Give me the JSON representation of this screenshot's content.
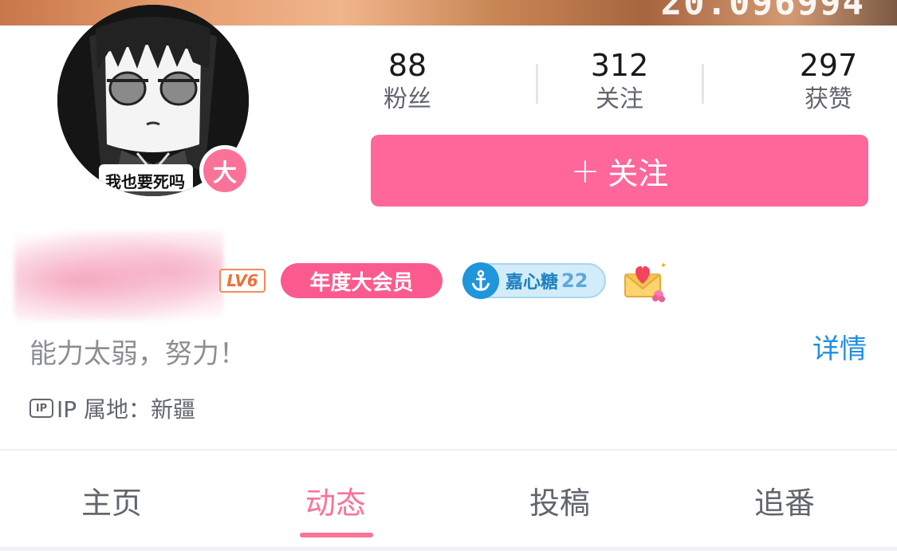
{
  "banner": {
    "overlay_text": "20.096994"
  },
  "avatar": {
    "caption": "我也要死吗",
    "level_badge": "大"
  },
  "stats": [
    {
      "value": "88",
      "label": "粉丝"
    },
    {
      "value": "312",
      "label": "关注"
    },
    {
      "value": "297",
      "label": "获赞"
    }
  ],
  "follow_button": {
    "plus": "+",
    "label": "关注"
  },
  "badges": {
    "level": "LV6",
    "vip": "年度大会员",
    "fan_medal_name": "嘉心糖",
    "fan_medal_level": "22"
  },
  "bio": {
    "text": "能力太弱，努力！",
    "details_link": "详情"
  },
  "ip": {
    "icon_text": "IP",
    "text": "IP 属地：新疆"
  },
  "tabs": [
    {
      "label": "主页",
      "active": false
    },
    {
      "label": "动态",
      "active": true
    },
    {
      "label": "投稿",
      "active": false
    },
    {
      "label": "追番",
      "active": false
    }
  ],
  "colors": {
    "accent": "#fb7299",
    "follow_button": "#ff6699",
    "link": "#1e8fe0"
  }
}
